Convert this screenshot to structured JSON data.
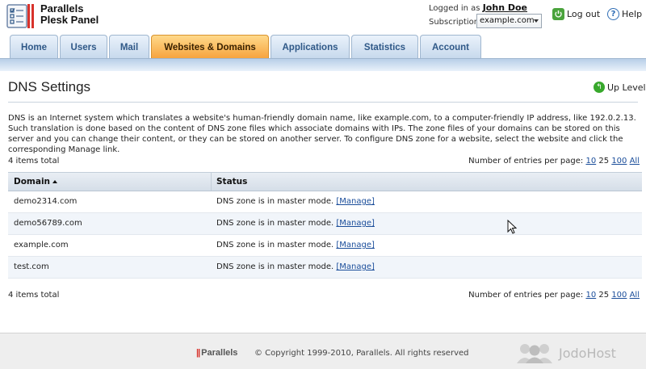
{
  "header": {
    "brand_line1": "Parallels",
    "brand_line2": "Plesk Panel",
    "logged_in_label": "Logged in as",
    "user_name": "John Doe",
    "subscription_label": "Subscription",
    "subscription_value": "example.com",
    "logout_label": "Log out",
    "help_label": "Help"
  },
  "tabs": [
    {
      "label": "Home"
    },
    {
      "label": "Users"
    },
    {
      "label": "Mail"
    },
    {
      "label": "Websites & Domains"
    },
    {
      "label": "Applications"
    },
    {
      "label": "Statistics"
    },
    {
      "label": "Account"
    }
  ],
  "active_tab": "Websites & Domains",
  "page": {
    "title": "DNS Settings",
    "up_level": "Up Level",
    "description": "DNS is an Internet system which translates a website's human-friendly domain name, like example.com, to a computer-friendly IP address, like 192.0.2.13. Such translation is done based on the content of DNS zone files which associate domains with IPs. The zone files of your domains can be stored on this server and you can change their content, or they can be stored on another server. To configure DNS zone for a website, select the website and click the corresponding Manage link.",
    "items_total": "4 items total",
    "per_page_label": "Number of entries per page:",
    "per_page_options": [
      "10",
      "25",
      "100",
      "All"
    ],
    "per_page_selected": "25"
  },
  "table": {
    "columns": [
      "Domain",
      "Status"
    ],
    "rows": [
      {
        "domain": "demo2314.com",
        "status": "DNS zone is in master mode.",
        "action": "[Manage]"
      },
      {
        "domain": "demo56789.com",
        "status": "DNS zone is in master mode.",
        "action": "[Manage]"
      },
      {
        "domain": "example.com",
        "status": "DNS zone is in master mode.",
        "action": "[Manage]"
      },
      {
        "domain": "test.com",
        "status": "DNS zone is in master mode.",
        "action": "[Manage]"
      }
    ]
  },
  "footer": {
    "brand": "Parallels",
    "copyright": "© Copyright 1999-2010, Parallels. All rights reserved",
    "watermark": "JodoHost"
  },
  "colors": {
    "tab_active": "#f6a23c",
    "tab_inactive": "#c6d8ec",
    "link": "#1a4d9a"
  }
}
